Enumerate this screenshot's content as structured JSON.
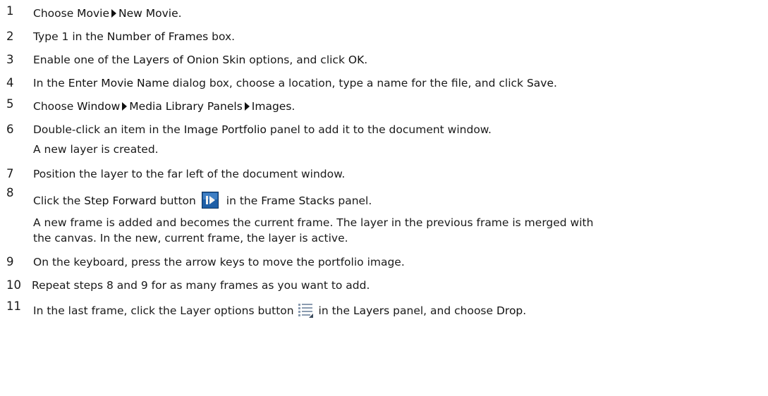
{
  "steps": [
    {
      "num": "1",
      "a": "Choose ",
      "b1": "Movie",
      "b2": "New Movie",
      "c": "."
    },
    {
      "num": "2",
      "a": "Type 1 in the ",
      "b": "Number of Frames",
      "c": " box."
    },
    {
      "num": "3",
      "a": "Enable one of the ",
      "b": "Layers of Onion Skin",
      "c": " options, and click ",
      "d": "OK",
      "e": "."
    },
    {
      "num": "4",
      "a": "In the ",
      "b": "Enter Movie Name",
      "c": " dialog box, choose a location, type a name for the file, and click ",
      "d": "Save",
      "e": "."
    },
    {
      "num": "5",
      "a": "Choose ",
      "b1": "Window",
      "b2": "Media Library Panels",
      "b3": "Images",
      "c": "."
    },
    {
      "num": "6",
      "a": "Double-click an item in the ",
      "b": "Image Portfolio",
      "c": " panel to add it to the document window.",
      "sub": "A new layer is created."
    },
    {
      "num": "7",
      "a": "Position the layer to the far left of the document window."
    },
    {
      "num": "8",
      "a": "Click the ",
      "b": "Step Forward",
      "c": " button",
      "d": " in the ",
      "e": "Frame Stacks",
      "f": " panel.",
      "sub1": "A new frame is added and becomes the current frame. The layer in the previous frame is merged with",
      "sub2": "the canvas. In the new, current frame, the layer is active."
    },
    {
      "num": "9",
      "a": "On the keyboard, press the arrow keys to move the portfolio image."
    },
    {
      "num": "10",
      "a": "Repeat steps 8 and 9 for as many frames as you want to add."
    },
    {
      "num": "11",
      "a": "In the last frame, click the Layer options button",
      "c": " in the ",
      "d": "Layers",
      "e": " panel, and choose ",
      "f": "Drop",
      "g": "."
    }
  ],
  "icons": {
    "step_forward": "step-forward-icon",
    "layer_options": "layer-options-icon"
  }
}
